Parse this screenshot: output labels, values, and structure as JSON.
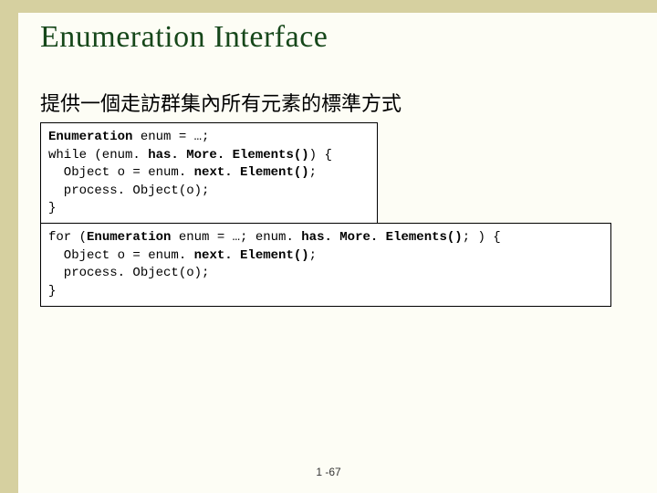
{
  "slide": {
    "title": "Enumeration Interface",
    "subtitle": "提供一個走訪群集內所有元素的標準方式",
    "page_number": "1 -67"
  },
  "code1": {
    "l1a": "Enumeration",
    "l1b": " enum = …;",
    "l2a": "while (enum. ",
    "l2b": "has. More. Elements()",
    "l2c": ") {",
    "l3a": "  Object o = enum. ",
    "l3b": "next. Element()",
    "l3c": ";",
    "l4": "  process. Object(o);",
    "l5": "}"
  },
  "code2": {
    "l1a": "for (",
    "l1b": "Enumeration",
    "l1c": " enum = …; enum. ",
    "l1d": "has. More. Elements()",
    "l1e": "; ) {",
    "l2a": "  Object o = enum. ",
    "l2b": "next. Element()",
    "l2c": ";",
    "l3": "  process. Object(o);",
    "l4": "}"
  }
}
